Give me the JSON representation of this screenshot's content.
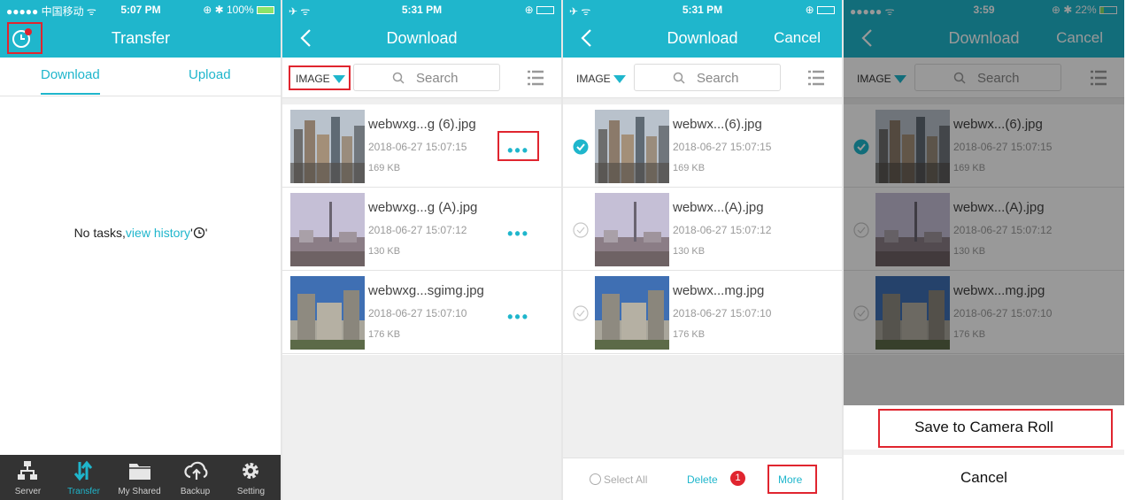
{
  "colors": {
    "accent": "#1fb6cc",
    "header": "#1fb6cc",
    "highlight": "#e0252f",
    "tabbar": "#333333"
  },
  "panel1": {
    "status": {
      "carrier": "●●●●● 中国移动 ᯤ",
      "time": "5:07 PM",
      "battery": "⊕ ✱ 100%"
    },
    "title": "Transfer",
    "tabs": [
      "Download",
      "Upload"
    ],
    "empty": {
      "text": "No tasks,",
      "link": "view history"
    },
    "tabbar": [
      {
        "label": "Server",
        "icon": "server-icon"
      },
      {
        "label": "Transfer",
        "icon": "transfer-icon",
        "active": true
      },
      {
        "label": "My Shared",
        "icon": "folder-icon"
      },
      {
        "label": "Backup",
        "icon": "cloud-upload-icon"
      },
      {
        "label": "Setting",
        "icon": "gear-icon"
      }
    ]
  },
  "panel2": {
    "status": {
      "left": "✈ ᯤ",
      "time": "5:31 PM",
      "right": "⊕"
    },
    "title": "Download",
    "filter": "IMAGE",
    "search_placeholder": "Search",
    "files": [
      {
        "name": "webwxg...g (6).jpg",
        "date": "2018-06-27 15:07:15",
        "size": "169 KB"
      },
      {
        "name": "webwxg...g (A).jpg",
        "date": "2018-06-27 15:07:12",
        "size": "130 KB"
      },
      {
        "name": "webwxg...sgimg.jpg",
        "date": "2018-06-27 15:07:10",
        "size": "176 KB"
      }
    ],
    "more_dots": "•••"
  },
  "panel3": {
    "status": {
      "left": "✈ ᯤ",
      "time": "5:31 PM",
      "right": "⊕"
    },
    "title": "Download",
    "cancel": "Cancel",
    "filter": "IMAGE",
    "search_placeholder": "Search",
    "files": [
      {
        "name": "webwx...(6).jpg",
        "date": "2018-06-27 15:07:15",
        "size": "169 KB",
        "checked": true
      },
      {
        "name": "webwx...(A).jpg",
        "date": "2018-06-27 15:07:12",
        "size": "130 KB",
        "checked": false
      },
      {
        "name": "webwx...mg.jpg",
        "date": "2018-06-27 15:07:10",
        "size": "176 KB",
        "checked": false
      }
    ],
    "bottom": {
      "select_all": "Select All",
      "delete": "Delete",
      "badge": "1",
      "more": "More"
    }
  },
  "panel4": {
    "status": {
      "left": "●●●●● ᯤ",
      "time": "3:59",
      "right": "⊕ ✱ 22%"
    },
    "title": "Download",
    "cancel": "Cancel",
    "filter": "IMAGE",
    "search_placeholder": "Search",
    "files": [
      {
        "name": "webwx...(6).jpg",
        "date": "2018-06-27 15:07:15",
        "size": "169 KB",
        "checked": true
      },
      {
        "name": "webwx...(A).jpg",
        "date": "2018-06-27 15:07:12",
        "size": "130 KB",
        "checked": false
      },
      {
        "name": "webwx...mg.jpg",
        "date": "2018-06-27 15:07:10",
        "size": "176 KB",
        "checked": false
      }
    ],
    "sheet": {
      "save": "Save to Camera Roll",
      "cancel": "Cancel"
    }
  }
}
